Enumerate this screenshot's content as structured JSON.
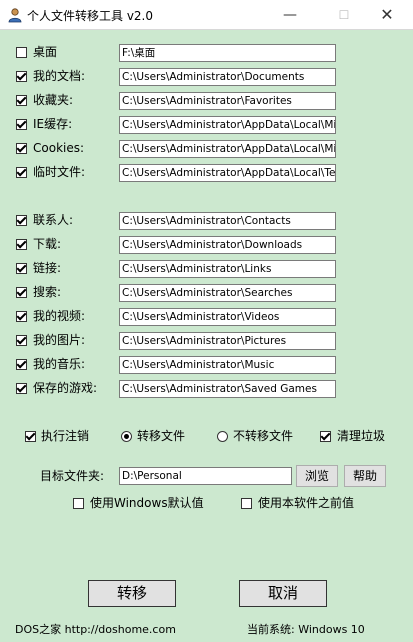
{
  "window": {
    "title": "个人文件转移工具 v2.0",
    "minimize": "—",
    "maximize": "☐",
    "close": "✕"
  },
  "folders": [
    {
      "label": "桌面",
      "checked": false,
      "path": "F:\\桌面"
    },
    {
      "label": "我的文档:",
      "checked": true,
      "path": "C:\\Users\\Administrator\\Documents"
    },
    {
      "label": "收藏夹:",
      "checked": true,
      "path": "C:\\Users\\Administrator\\Favorites"
    },
    {
      "label": "IE缓存:",
      "checked": true,
      "path": "C:\\Users\\Administrator\\AppData\\Local\\Microsoft"
    },
    {
      "label": "Cookies:",
      "checked": true,
      "path": "C:\\Users\\Administrator\\AppData\\Local\\Microsoft"
    },
    {
      "label": "临时文件:",
      "checked": true,
      "path": "C:\\Users\\Administrator\\AppData\\Local\\Temp"
    },
    {
      "label": "联系人:",
      "checked": true,
      "path": "C:\\Users\\Administrator\\Contacts"
    },
    {
      "label": "下载:",
      "checked": true,
      "path": "C:\\Users\\Administrator\\Downloads"
    },
    {
      "label": "链接:",
      "checked": true,
      "path": "C:\\Users\\Administrator\\Links"
    },
    {
      "label": "搜索:",
      "checked": true,
      "path": "C:\\Users\\Administrator\\Searches"
    },
    {
      "label": "我的视频:",
      "checked": true,
      "path": "C:\\Users\\Administrator\\Videos"
    },
    {
      "label": "我的图片:",
      "checked": true,
      "path": "C:\\Users\\Administrator\\Pictures"
    },
    {
      "label": "我的音乐:",
      "checked": true,
      "path": "C:\\Users\\Administrator\\Music"
    },
    {
      "label": "保存的游戏:",
      "checked": true,
      "path": "C:\\Users\\Administrator\\Saved Games"
    }
  ],
  "options": {
    "run_logoff": {
      "label": "执行注销",
      "checked": true
    },
    "transfer": {
      "label": "转移文件",
      "selected": true
    },
    "no_transfer": {
      "label": "不转移文件",
      "selected": false
    },
    "clean_junk": {
      "label": "清理垃圾",
      "checked": true
    }
  },
  "target": {
    "label": "目标文件夹:",
    "value": "D:\\Personal",
    "browse_label": "浏览",
    "help_label": "帮助",
    "use_windows_default": {
      "label": "使用Windows默认值",
      "checked": false
    },
    "use_previous": {
      "label": "使用本软件之前值",
      "checked": false
    }
  },
  "actions": {
    "transfer_label": "转移",
    "cancel_label": "取消"
  },
  "footer": {
    "left": "DOS之家 http://doshome.com",
    "right": "当前系统: Windows 10"
  },
  "colors": {
    "background": "#cce8cf",
    "titlebar": "#ffffff"
  }
}
